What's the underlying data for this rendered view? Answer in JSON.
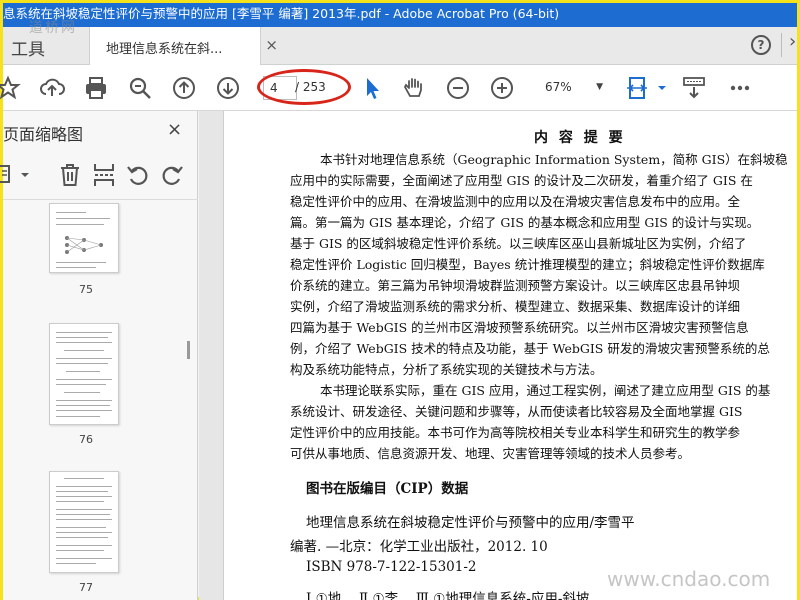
{
  "window": {
    "title": "息系统在斜坡稳定性评价与预警中的应用 [李雪平 编著] 2013年.pdf - Adobe Acrobat Pro (64-bit)",
    "watermark_top": "道桥网",
    "watermark_bottom": "www.cndao.com"
  },
  "tabs": {
    "tools": "工具",
    "document": "地理信息系统在斜...",
    "close": "×"
  },
  "toolbar": {
    "page_current": "4",
    "page_total": "/ 253",
    "zoom": "67%",
    "accent_color": "#1d6cd1",
    "highlight_color": "#d8251a"
  },
  "leftpane": {
    "title": "页面缩略图",
    "close": "×",
    "thumbnails": [
      {
        "label": "75"
      },
      {
        "label": "76"
      },
      {
        "label": "77"
      }
    ]
  },
  "document": {
    "heading": "内 容 提 要",
    "lines": [
      "本书针对地理信息系统（Geographic Information System，简称 GIS）在斜坡稳",
      "应用中的实际需要，全面阐述了应用型 GIS 的设计及二次研发，着重介绍了 GIS 在",
      "稳定性评价中的应用、在滑坡监测中的应用以及在滑坡灾害信息发布中的应用。全",
      "篇。第一篇为 GIS 基本理论，介绍了 GIS 的基本概念和应用型 GIS 的设计与实现。",
      "基于 GIS 的区域斜坡稳定性评价系统。以三峡库区巫山县新城址区为实例，介绍了",
      "稳定性评价 Logistic 回归模型，Bayes 统计推理模型的建立；斜坡稳定性评价数据库",
      "价系统的建立。第三篇为吊钟坝滑坡群监测预警方案设计。以三峡库区忠县吊钟坝",
      "实例，介绍了滑坡监测系统的需求分析、模型建立、数据采集、数据库设计的详细",
      "四篇为基于 WebGIS 的兰州市区滑坡预警系统研究。以兰州市区滑坡灾害预警信息",
      "例，介绍了 WebGIS 技术的特点及功能，基于 WebGIS 研发的滑坡灾害预警系统的总",
      "构及系统功能特点，分析了系统实现的关键技术与方法。",
      "本书理论联系实际，重在 GIS 应用，通过工程实例，阐述了建立应用型 GIS 的基",
      "系统设计、研发途径、关键问题和步骤等，从而使读者比较容易及全面地掌握 GIS",
      "定性评价中的应用技能。本书可作为高等院校相关专业本科学生和研究生的教学参",
      "可供从事地质、信息资源开发、地理、灾害管理等领域的技术人员参考。"
    ],
    "cip_title": "图书在版编目（CIP）数据",
    "cip_lines": [
      "地理信息系统在斜坡稳定性评价与预警中的应用/李雪平",
      "编著. —北京：化学工业出版社，2012. 10",
      "ISBN 978-7-122-15301-2",
      "Ⅰ.①地…  Ⅱ.①李…  Ⅲ.①地理信息系统-应用-斜坡"
    ]
  }
}
